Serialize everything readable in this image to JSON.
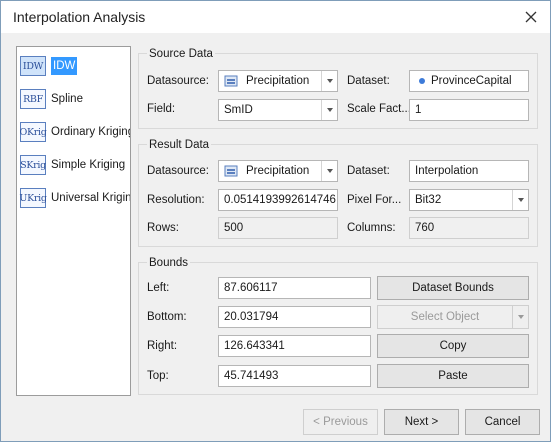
{
  "window": {
    "title": "Interpolation Analysis"
  },
  "methods": [
    {
      "icon": "IDW",
      "label": "IDW",
      "selected": true
    },
    {
      "icon": "RBF",
      "label": "Spline",
      "selected": false
    },
    {
      "icon": "OKrig",
      "label": "Ordinary Kriging",
      "selected": false
    },
    {
      "icon": "SKrig",
      "label": "Simple Kriging",
      "selected": false
    },
    {
      "icon": "UKrig",
      "label": "Universal Kriging",
      "selected": false
    }
  ],
  "source": {
    "title": "Source Data",
    "datasource_label": "Datasource:",
    "datasource_value": "Precipitation",
    "dataset_label": "Dataset:",
    "dataset_value": "ProvinceCapital",
    "field_label": "Field:",
    "field_value": "SmID",
    "scale_label": "Scale Fact...",
    "scale_value": "1"
  },
  "result": {
    "title": "Result Data",
    "datasource_label": "Datasource:",
    "datasource_value": "Precipitation",
    "dataset_label": "Dataset:",
    "dataset_value": "Interpolation",
    "resolution_label": "Resolution:",
    "resolution_value": "0.0514193992614746",
    "pixel_label": "Pixel For...",
    "pixel_value": "Bit32",
    "rows_label": "Rows:",
    "rows_value": "500",
    "columns_label": "Columns:",
    "columns_value": "760"
  },
  "bounds": {
    "title": "Bounds",
    "left_label": "Left:",
    "left_value": "87.606117",
    "bottom_label": "Bottom:",
    "bottom_value": "20.031794",
    "right_label": "Right:",
    "right_value": "126.643341",
    "top_label": "Top:",
    "top_value": "45.741493",
    "dataset_bounds_button": "Dataset Bounds",
    "select_object_button": "Select Object",
    "copy_button": "Copy",
    "paste_button": "Paste"
  },
  "footer": {
    "previous_button": "< Previous",
    "next_button": "Next >",
    "cancel_button": "Cancel"
  },
  "colors": {
    "selection": "#3399ff",
    "border": "#adadad",
    "background": "#f0f0f0"
  }
}
